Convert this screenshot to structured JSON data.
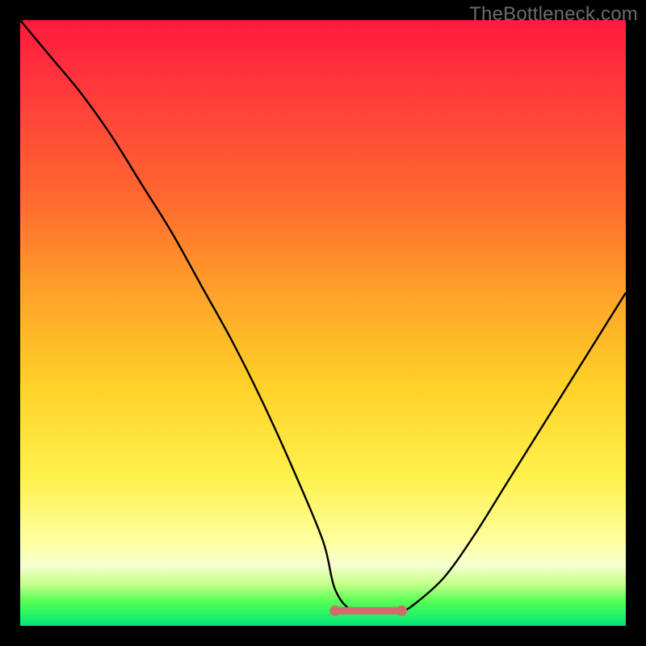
{
  "watermark": "TheBottleneck.com",
  "chart_data": {
    "type": "line",
    "title": "",
    "xlabel": "",
    "ylabel": "",
    "xlim": [
      0,
      100
    ],
    "ylim": [
      0,
      100
    ],
    "grid": false,
    "legend": false,
    "series": [
      {
        "name": "curve",
        "color": "#000000",
        "x": [
          0,
          5,
          10,
          15,
          20,
          25,
          30,
          35,
          40,
          45,
          50,
          52,
          55,
          60,
          63,
          65,
          70,
          75,
          80,
          85,
          90,
          95,
          100
        ],
        "y": [
          100,
          94,
          88,
          81,
          73,
          65,
          56,
          47,
          37,
          26,
          14,
          6,
          2.5,
          2.5,
          2.5,
          3.5,
          8,
          15,
          23,
          31,
          39,
          47,
          55
        ]
      },
      {
        "name": "flat-segment",
        "color": "#d46a6a",
        "x": [
          52,
          55,
          60,
          63
        ],
        "y": [
          2.5,
          2.5,
          2.5,
          2.5
        ]
      }
    ],
    "markers": [
      {
        "name": "flat-start",
        "x": 52,
        "y": 2.5,
        "color": "#d46a6a"
      },
      {
        "name": "flat-end",
        "x": 63,
        "y": 2.5,
        "color": "#d46a6a"
      }
    ]
  }
}
